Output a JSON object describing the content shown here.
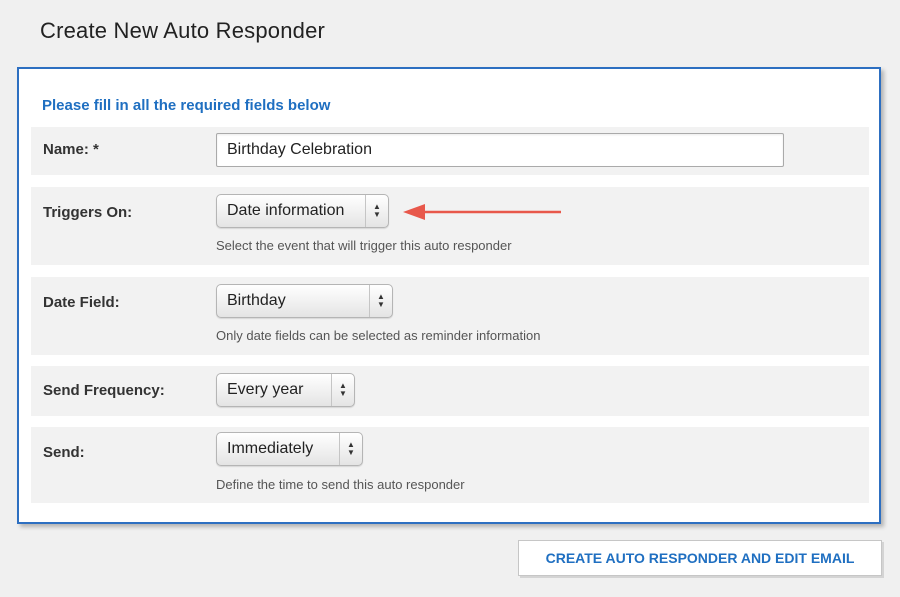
{
  "page": {
    "title": "Create New Auto Responder"
  },
  "form": {
    "instructions": "Please fill in all the required fields below",
    "name": {
      "label": "Name: *",
      "value": "Birthday Celebration"
    },
    "triggers_on": {
      "label": "Triggers On:",
      "selected": "Date information",
      "help": "Select the event that will trigger this auto responder"
    },
    "date_field": {
      "label": "Date Field:",
      "selected": "Birthday",
      "help": "Only date fields can be selected as reminder information"
    },
    "send_frequency": {
      "label": "Send Frequency:",
      "selected": "Every year"
    },
    "send": {
      "label": "Send:",
      "selected": "Immediately",
      "help": "Define the time to send this auto responder"
    }
  },
  "actions": {
    "submit_label": "CREATE AUTO RESPONDER AND EDIT EMAIL"
  },
  "colors": {
    "accent": "#1f6fc1",
    "panel_border": "#2d6fc1",
    "annotation_arrow": "#e8584b",
    "row_background": "#f2f2f2"
  },
  "icons": {
    "select_arrows": "updown-arrows-icon",
    "annotation": "red-arrow-icon"
  }
}
